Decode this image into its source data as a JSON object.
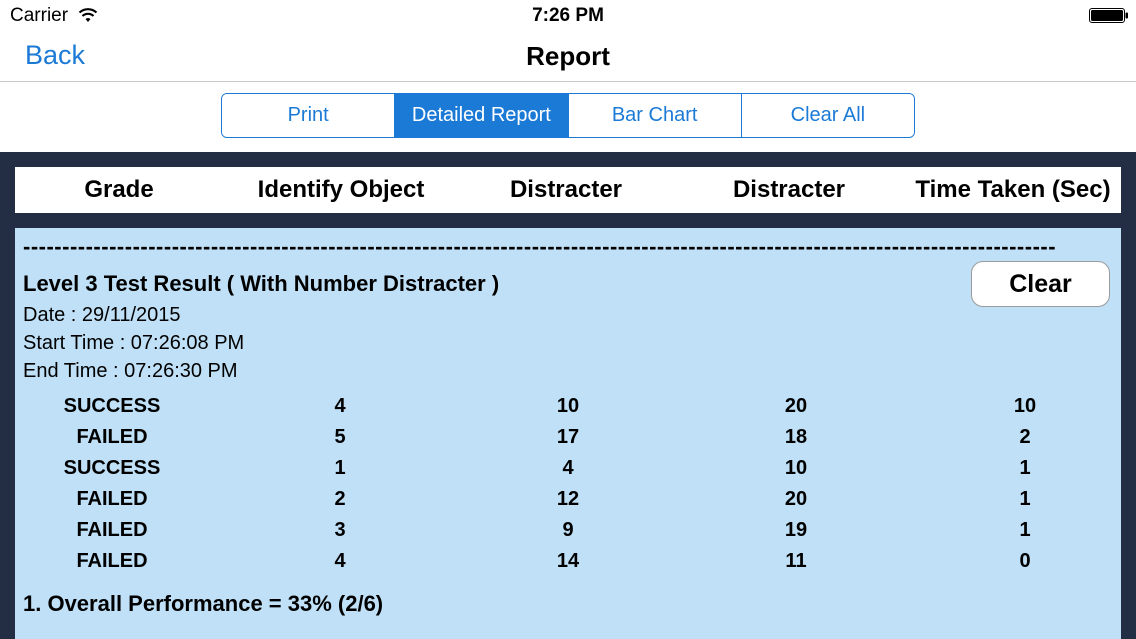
{
  "status_bar": {
    "carrier": "Carrier",
    "time": "7:26 PM",
    "wifi_icon": "wifi-icon",
    "battery_icon": "battery-icon"
  },
  "nav": {
    "back_label": "Back",
    "title": "Report"
  },
  "segments": [
    {
      "label": "Print",
      "selected": false
    },
    {
      "label": "Detailed Report",
      "selected": true
    },
    {
      "label": "Bar Chart",
      "selected": false
    },
    {
      "label": "Clear All",
      "selected": false
    }
  ],
  "table": {
    "headers": [
      "Grade",
      "Identify Object",
      "Distracter",
      "Distracter",
      "Time Taken (Sec)"
    ]
  },
  "report": {
    "dashes": "------------------------------------------------------------------------------------------------------------------------------------",
    "title": "Level 3 Test Result ( With Number Distracter )",
    "date": "Date : 29/11/2015",
    "start_time": "Start Time : 07:26:08 PM",
    "end_time": "End Time : 07:26:30 PM",
    "clear_label": "Clear",
    "rows": [
      [
        "SUCCESS",
        "4",
        "10",
        "20",
        "10"
      ],
      [
        "FAILED",
        "5",
        "17",
        "18",
        "2"
      ],
      [
        "SUCCESS",
        "1",
        "4",
        "10",
        "1"
      ],
      [
        "FAILED",
        "2",
        "12",
        "20",
        "1"
      ],
      [
        "FAILED",
        "3",
        "9",
        "19",
        "1"
      ],
      [
        "FAILED",
        "4",
        "14",
        "11",
        "0"
      ]
    ],
    "overall": "1. Overall Performance = 33% (2/6)"
  },
  "colors": {
    "accent": "#1b7ad6",
    "dark_panel": "#232d44",
    "report_bg": "#bfe0f6"
  }
}
